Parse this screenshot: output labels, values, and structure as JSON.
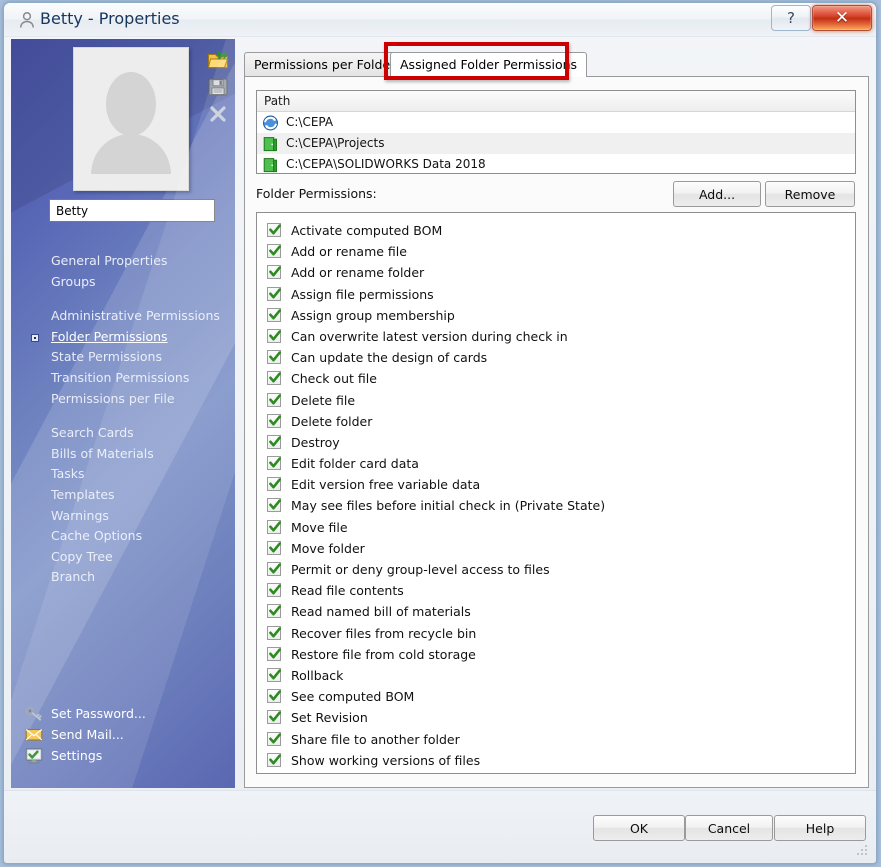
{
  "window": {
    "title": "Betty - Properties",
    "user_icon": "user-icon",
    "help_caption_label": "?",
    "close_caption_label": "✕"
  },
  "sidebar": {
    "avatar_alt": "user-photo-placeholder",
    "toolbar_icons": [
      {
        "name": "open-folder-icon"
      },
      {
        "name": "save-icon"
      },
      {
        "name": "delete-icon"
      }
    ],
    "name_field": {
      "value": "Betty",
      "placeholder": ""
    },
    "items": [
      {
        "label": "General Properties",
        "selected": false,
        "gap": false
      },
      {
        "label": "Groups",
        "selected": false,
        "gap": false
      },
      {
        "label": "Administrative Permissions",
        "selected": false,
        "gap": true
      },
      {
        "label": "Folder Permissions",
        "selected": true,
        "gap": false
      },
      {
        "label": "State Permissions",
        "selected": false,
        "gap": false
      },
      {
        "label": "Transition Permissions",
        "selected": false,
        "gap": false
      },
      {
        "label": "Permissions per File",
        "selected": false,
        "gap": false
      },
      {
        "label": "Search Cards",
        "selected": false,
        "gap": true
      },
      {
        "label": "Bills of Materials",
        "selected": false,
        "gap": false
      },
      {
        "label": "Tasks",
        "selected": false,
        "gap": false
      },
      {
        "label": "Templates",
        "selected": false,
        "gap": false
      },
      {
        "label": "Warnings",
        "selected": false,
        "gap": false
      },
      {
        "label": "Cache Options",
        "selected": false,
        "gap": false
      },
      {
        "label": "Copy Tree",
        "selected": false,
        "gap": false
      },
      {
        "label": "Branch",
        "selected": false,
        "gap": false
      }
    ],
    "footer_items": [
      {
        "label": "Set Password...",
        "icon": "key-icon"
      },
      {
        "label": "Send Mail...",
        "icon": "envelope-icon"
      },
      {
        "label": "Settings",
        "icon": "monitor-check-icon"
      }
    ]
  },
  "tabs": [
    {
      "label": "Permissions per Folder",
      "active": false
    },
    {
      "label": "Assigned Folder Permissions",
      "active": true,
      "highlighted": true
    }
  ],
  "path_list": {
    "header": "Path",
    "rows": [
      {
        "path": "C:\\CEPA",
        "icon": "vault-root-icon",
        "selected": false
      },
      {
        "path": "C:\\CEPA\\Projects",
        "icon": "folder-icon",
        "selected": true
      },
      {
        "path": "C:\\CEPA\\SOLIDWORKS Data 2018",
        "icon": "folder-icon",
        "selected": false
      }
    ]
  },
  "permissions_section": {
    "label": "Folder Permissions:",
    "add_label": "Add...",
    "remove_label": "Remove",
    "items": [
      {
        "label": "Activate computed BOM",
        "checked": true
      },
      {
        "label": "Add or rename file",
        "checked": true
      },
      {
        "label": "Add or rename folder",
        "checked": true
      },
      {
        "label": "Assign file permissions",
        "checked": true
      },
      {
        "label": "Assign group membership",
        "checked": true
      },
      {
        "label": "Can overwrite latest version during check in",
        "checked": true
      },
      {
        "label": "Can update the design of cards",
        "checked": true
      },
      {
        "label": "Check out file",
        "checked": true
      },
      {
        "label": "Delete file",
        "checked": true
      },
      {
        "label": "Delete folder",
        "checked": true
      },
      {
        "label": "Destroy",
        "checked": true
      },
      {
        "label": "Edit folder card data",
        "checked": true
      },
      {
        "label": "Edit version free variable data",
        "checked": true
      },
      {
        "label": "May see files before initial check in (Private State)",
        "checked": true
      },
      {
        "label": "Move file",
        "checked": true
      },
      {
        "label": "Move folder",
        "checked": true
      },
      {
        "label": "Permit or deny group-level access to files",
        "checked": true
      },
      {
        "label": "Read file contents",
        "checked": true
      },
      {
        "label": "Read named bill of materials",
        "checked": true
      },
      {
        "label": "Recover files from recycle bin",
        "checked": true
      },
      {
        "label": "Restore file from cold storage",
        "checked": true
      },
      {
        "label": "Rollback",
        "checked": true
      },
      {
        "label": "See computed BOM",
        "checked": true
      },
      {
        "label": "Set Revision",
        "checked": true
      },
      {
        "label": "Share file to another folder",
        "checked": true
      },
      {
        "label": "Show working versions of files",
        "checked": true
      }
    ]
  },
  "dialog_buttons": {
    "ok": "OK",
    "cancel": "Cancel",
    "help": "Help"
  },
  "colors": {
    "highlight_red": "#cc0000",
    "close_button_red": "#d9442a",
    "check_green": "#2e8b21",
    "sidebar_blue": "#5563b4",
    "title_text": "#17365d"
  }
}
